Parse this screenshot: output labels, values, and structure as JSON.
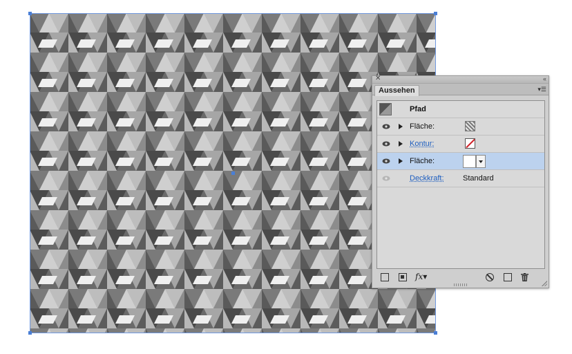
{
  "panel": {
    "title": "Aussehen",
    "icons": [
      "close-icon",
      "collapse-icon",
      "panel-menu-icon"
    ]
  },
  "appearance": {
    "object_type": "Pfad",
    "rows": [
      {
        "label": "Fläche:",
        "value": "",
        "linked": false,
        "swatch": "pattern"
      },
      {
        "label": "Kontur:",
        "value": "",
        "linked": true,
        "swatch": "none"
      },
      {
        "label": "Fläche:",
        "value": "",
        "linked": false,
        "swatch": "white",
        "selected": true
      },
      {
        "label": "Deckkraft:",
        "value": "Standard",
        "linked": true
      }
    ]
  },
  "toolbar": {
    "fx_label": "fx"
  },
  "colors": {
    "selection": "#4a7fd6",
    "row_selected": "#bcd2ee",
    "link_text": "#1f5fc0",
    "pattern_light": "#f2f2f2",
    "pattern_mid": "#b5b5b5",
    "pattern_dark": "#4a4a4a"
  }
}
